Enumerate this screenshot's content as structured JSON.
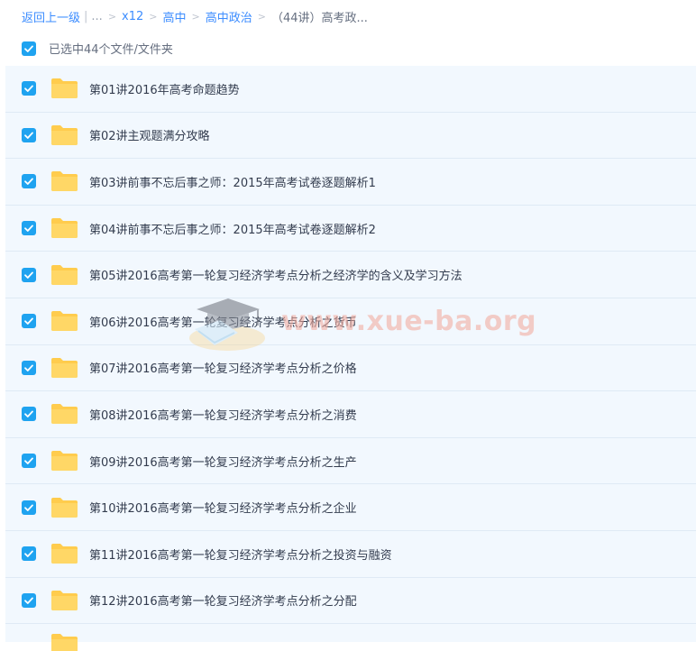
{
  "breadcrumb": {
    "back": "返回上一级",
    "bar": "|",
    "ellipsis": "...",
    "sep": ">",
    "items": [
      "x12",
      "高中",
      "高中政治"
    ],
    "current": "（44讲）高考政..."
  },
  "select_all": {
    "label": "已选中44个文件/文件夹",
    "checked": true
  },
  "files": [
    {
      "name": "第01讲2016年高考命题趋势",
      "checked": true,
      "icon": "folder-icon"
    },
    {
      "name": "第02讲主观题满分攻略",
      "checked": true,
      "icon": "folder-icon"
    },
    {
      "name": "第03讲前事不忘后事之师：2015年高考试卷逐题解析1",
      "checked": true,
      "icon": "folder-icon"
    },
    {
      "name": "第04讲前事不忘后事之师：2015年高考试卷逐题解析2",
      "checked": true,
      "icon": "folder-icon"
    },
    {
      "name": "第05讲2016高考第一轮复习经济学考点分析之经济学的含义及学习方法",
      "checked": true,
      "icon": "folder-icon"
    },
    {
      "name": "第06讲2016高考第一轮复习经济学考点分析之货币",
      "checked": true,
      "icon": "folder-icon"
    },
    {
      "name": "第07讲2016高考第一轮复习经济学考点分析之价格",
      "checked": true,
      "icon": "folder-icon"
    },
    {
      "name": "第08讲2016高考第一轮复习经济学考点分析之消费",
      "checked": true,
      "icon": "folder-icon"
    },
    {
      "name": "第09讲2016高考第一轮复习经济学考点分析之生产",
      "checked": true,
      "icon": "folder-icon"
    },
    {
      "name": "第10讲2016高考第一轮复习经济学考点分析之企业",
      "checked": true,
      "icon": "folder-icon"
    },
    {
      "name": "第11讲2016高考第一轮复习经济学考点分析之投资与融资",
      "checked": true,
      "icon": "folder-icon"
    },
    {
      "name": "第12讲2016高考第一轮复习经济学考点分析之分配",
      "checked": true,
      "icon": "folder-icon"
    }
  ],
  "watermark": {
    "text": "www.xue-ba.org"
  },
  "colors": {
    "accent": "#1fa3f0",
    "link": "#3b8cff",
    "row_bg": "#f2f8fe",
    "folder": "#ffcc4d",
    "watermark": "#f3a89a"
  }
}
